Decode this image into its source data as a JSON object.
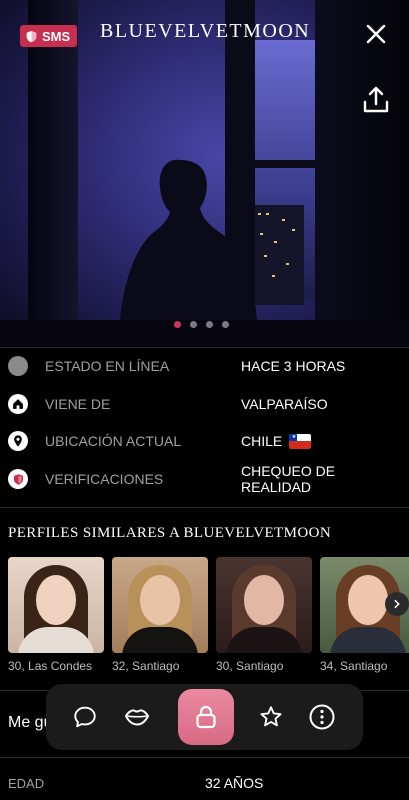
{
  "hero": {
    "badge": "SMS",
    "title": "BLUEVELVETMOON",
    "photo_count": 4,
    "active_photo": 1
  },
  "info": [
    {
      "icon": "status-dot-icon",
      "label": "ESTADO EN LÍNEA",
      "value": "HACE 3 HORAS"
    },
    {
      "icon": "home-icon",
      "label": "VIENE DE",
      "value": "VALPARAÍSO"
    },
    {
      "icon": "location-pin-icon",
      "label": "UBICACIÓN ACTUAL",
      "value": "CHILE",
      "flag": "chile-flag-icon"
    },
    {
      "icon": "shield-icon",
      "label": "VERIFICACIONES",
      "value": "CHEQUEO DE REALIDAD"
    }
  ],
  "similar": {
    "title": "PERFILES SIMILARES A BLUEVELVETMOON",
    "profiles": [
      {
        "caption": "30, Las Condes"
      },
      {
        "caption": "32, Santiago"
      },
      {
        "caption": "30, Santiago"
      },
      {
        "caption": "34, Santiago"
      }
    ]
  },
  "likes": {
    "text": "Me gu"
  },
  "age": {
    "label": "EDAD",
    "value": "32 AÑOS"
  },
  "colors": {
    "accent": "#c62f4f",
    "lock_button": "#e07a93",
    "background": "#000000"
  }
}
